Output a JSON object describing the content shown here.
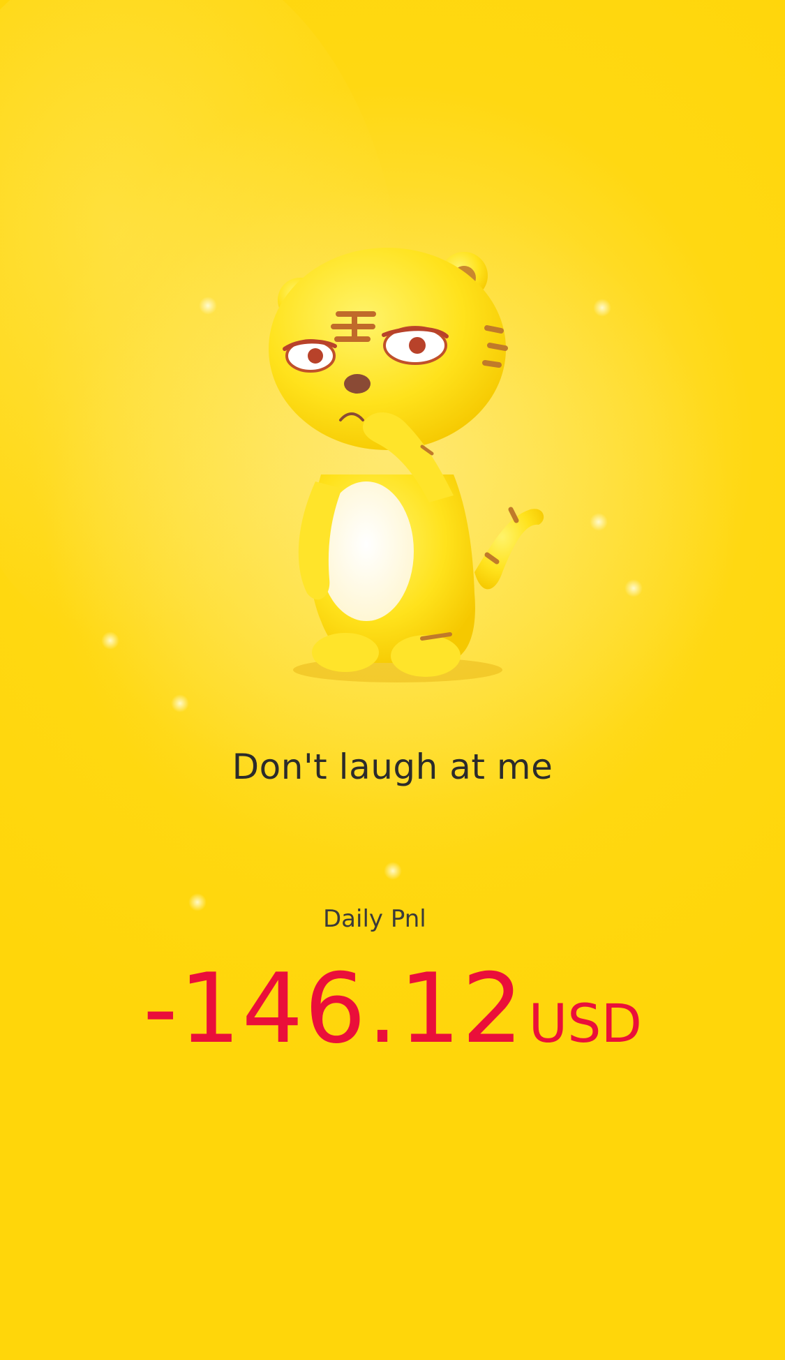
{
  "mascot": {
    "icon": "tiger-mascot-icon"
  },
  "message": {
    "text": "Don't laugh at me"
  },
  "pnl": {
    "label": "Daily Pnl",
    "value": "-146.12",
    "unit": "USD"
  },
  "colors": {
    "background": "#ffd60a",
    "loss": "#ea0f3a",
    "text": "#2b2b2b"
  }
}
